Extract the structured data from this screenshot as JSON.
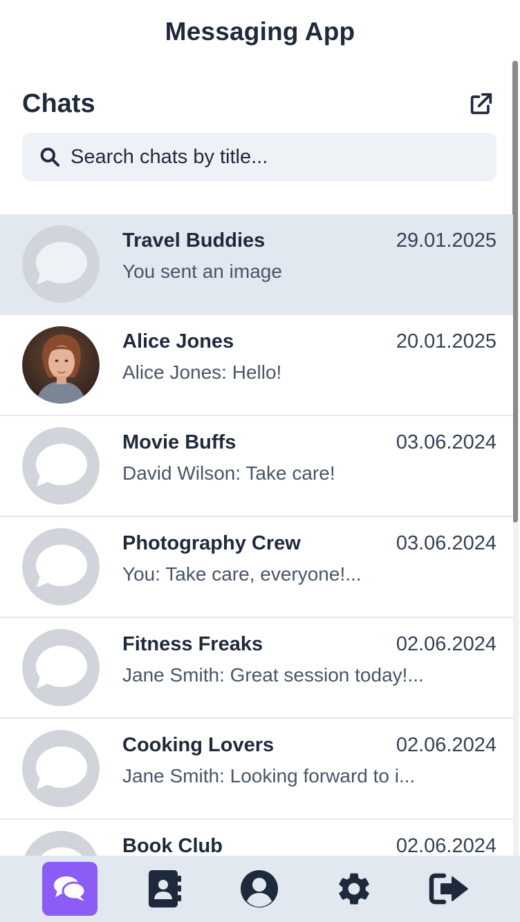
{
  "app": {
    "title": "Messaging App"
  },
  "chats_header": {
    "title": "Chats",
    "new_chat_icon": "external-link-icon"
  },
  "search": {
    "placeholder": "Search chats by title...",
    "value": "",
    "icon": "search-icon"
  },
  "colors": {
    "accent": "#8b5cf6",
    "text": "#1e293b",
    "active_row": "#e2e8f0",
    "nav_bg": "#e2e8f0",
    "avatar_placeholder": "#d1d5db"
  },
  "chats": [
    {
      "title": "Travel Buddies",
      "date": "29.01.2025",
      "preview": "You sent an image",
      "avatar": "group-placeholder",
      "active": true
    },
    {
      "title": "Alice Jones",
      "date": "20.01.2025",
      "preview": "Alice Jones: Hello!",
      "avatar": "user-photo",
      "active": false
    },
    {
      "title": "Movie Buffs",
      "date": "03.06.2024",
      "preview": "David Wilson: Take care!",
      "avatar": "group-placeholder",
      "active": false
    },
    {
      "title": "Photography Crew",
      "date": "03.06.2024",
      "preview": "You: Take care, everyone!...",
      "avatar": "group-placeholder",
      "active": false
    },
    {
      "title": "Fitness Freaks",
      "date": "02.06.2024",
      "preview": "Jane Smith: Great session today!...",
      "avatar": "group-placeholder",
      "active": false
    },
    {
      "title": "Cooking Lovers",
      "date": "02.06.2024",
      "preview": "Jane Smith: Looking forward to i...",
      "avatar": "group-placeholder",
      "active": false
    },
    {
      "title": "Book Club",
      "date": "02.06.2024",
      "preview": "",
      "avatar": "group-placeholder",
      "active": false
    }
  ],
  "nav": [
    {
      "icon": "chats-icon",
      "active": true
    },
    {
      "icon": "contacts-icon",
      "active": false
    },
    {
      "icon": "profile-icon",
      "active": false
    },
    {
      "icon": "settings-icon",
      "active": false
    },
    {
      "icon": "logout-icon",
      "active": false
    }
  ]
}
